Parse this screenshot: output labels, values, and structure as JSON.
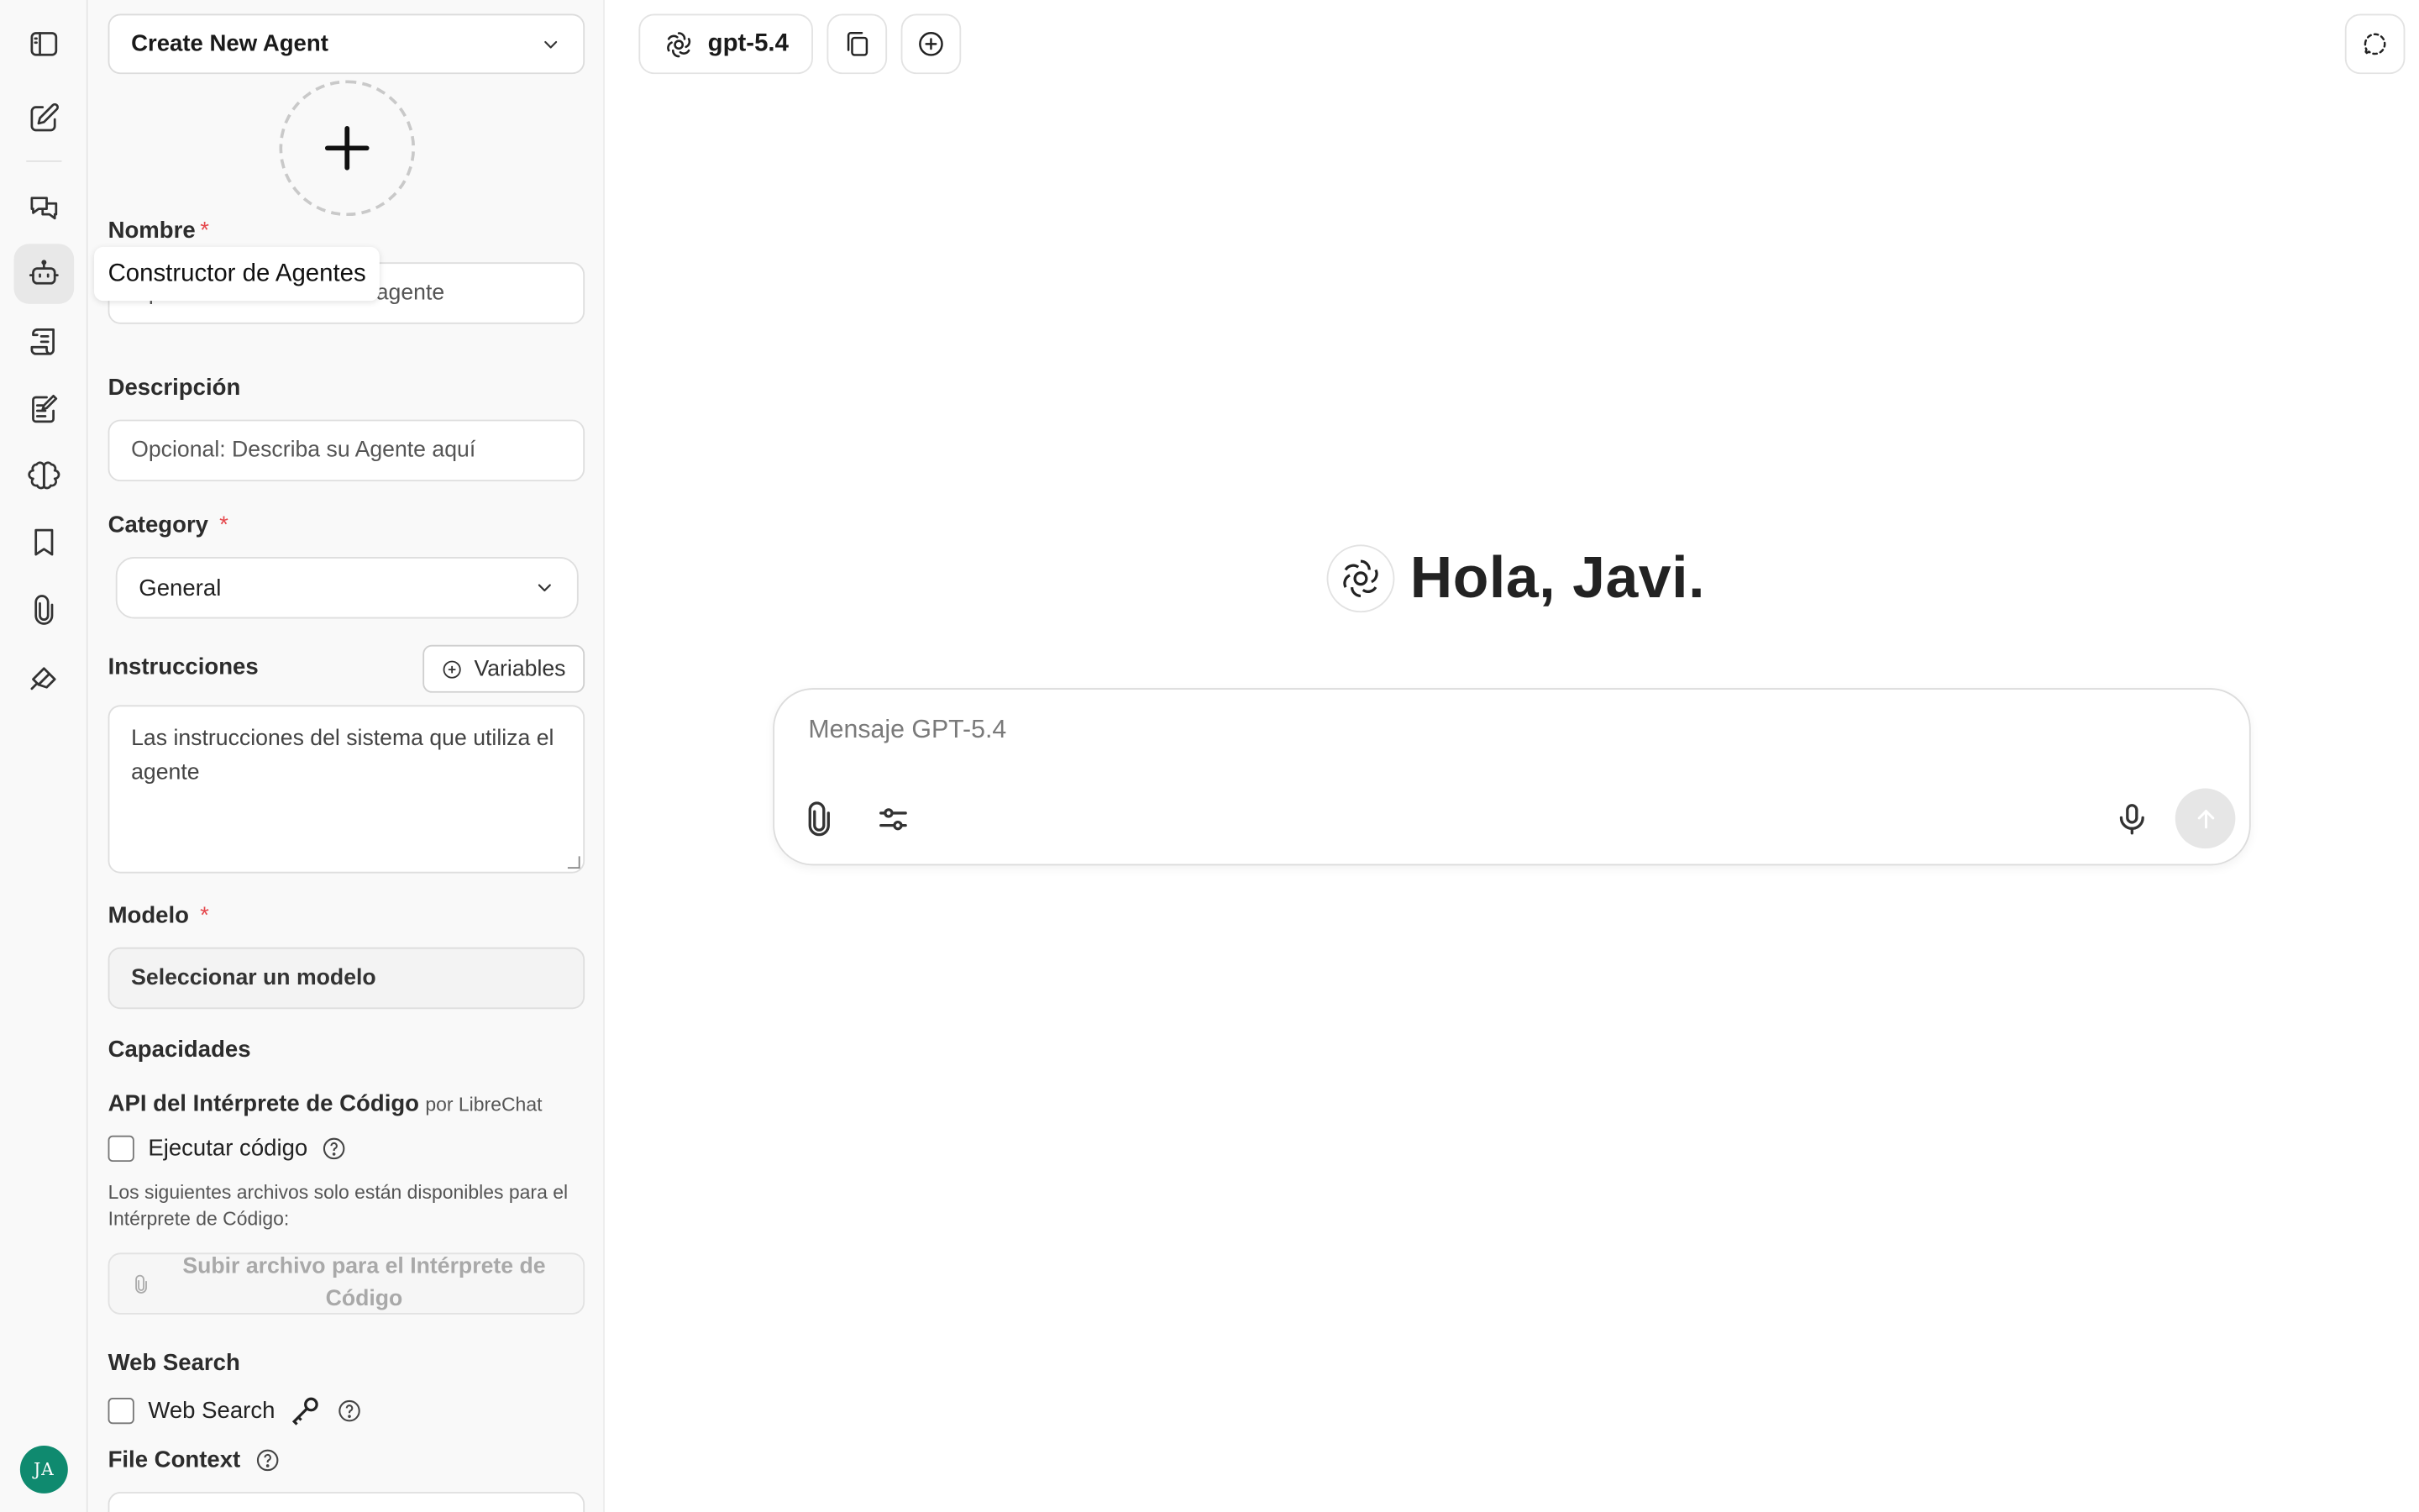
{
  "rail": {
    "items": [
      {
        "icon": "sidebar-toggle-icon"
      },
      {
        "icon": "new-chat-icon"
      },
      {
        "icon": "conversations-icon"
      },
      {
        "icon": "agent-builder-icon"
      },
      {
        "icon": "prompts-icon"
      },
      {
        "icon": "memories-icon"
      },
      {
        "icon": "brain-icon"
      },
      {
        "icon": "bookmarks-icon"
      },
      {
        "icon": "attachments-icon"
      },
      {
        "icon": "tools-icon"
      }
    ],
    "avatar_initials": "JA",
    "avatar_color": "#0f8a6f"
  },
  "tooltip": "Constructor de Agentes",
  "panel": {
    "agent_select": "Create New Agent",
    "name_label": "Nombre",
    "name_required": "*",
    "name_placeholder": "Opcional: El nombre del agente",
    "description_label": "Descripción",
    "description_placeholder": "Opcional: Describa su Agente aquí",
    "category_label": "Category",
    "category_required": "*",
    "category_value": "General",
    "instructions_label": "Instrucciones",
    "variables_button": "Variables",
    "instructions_placeholder": "Las instrucciones del sistema que utiliza el agente",
    "model_label": "Modelo",
    "model_required": "*",
    "model_value": "Seleccionar un modelo",
    "capabilities_label": "Capacidades",
    "code_api_label": "API del Intérprete de Código",
    "code_api_by": "por LibreChat",
    "run_code_label": "Ejecutar código",
    "code_files_note": "Los siguientes archivos solo están disponibles para el Intérprete de Código:",
    "upload_code_file": "Subir archivo para el Intérprete de Código",
    "web_search_section": "Web Search",
    "web_search_label": "Web Search",
    "file_context_label": "File Context"
  },
  "topbar": {
    "model_name": "gpt-5.4"
  },
  "main": {
    "greeting": "Hola, Javi.",
    "composer_placeholder": "Mensaje GPT-5.4"
  },
  "colors": {
    "accent_required": "#e5484d",
    "background": "#ffffff",
    "panel_background": "#f9f9f9"
  }
}
